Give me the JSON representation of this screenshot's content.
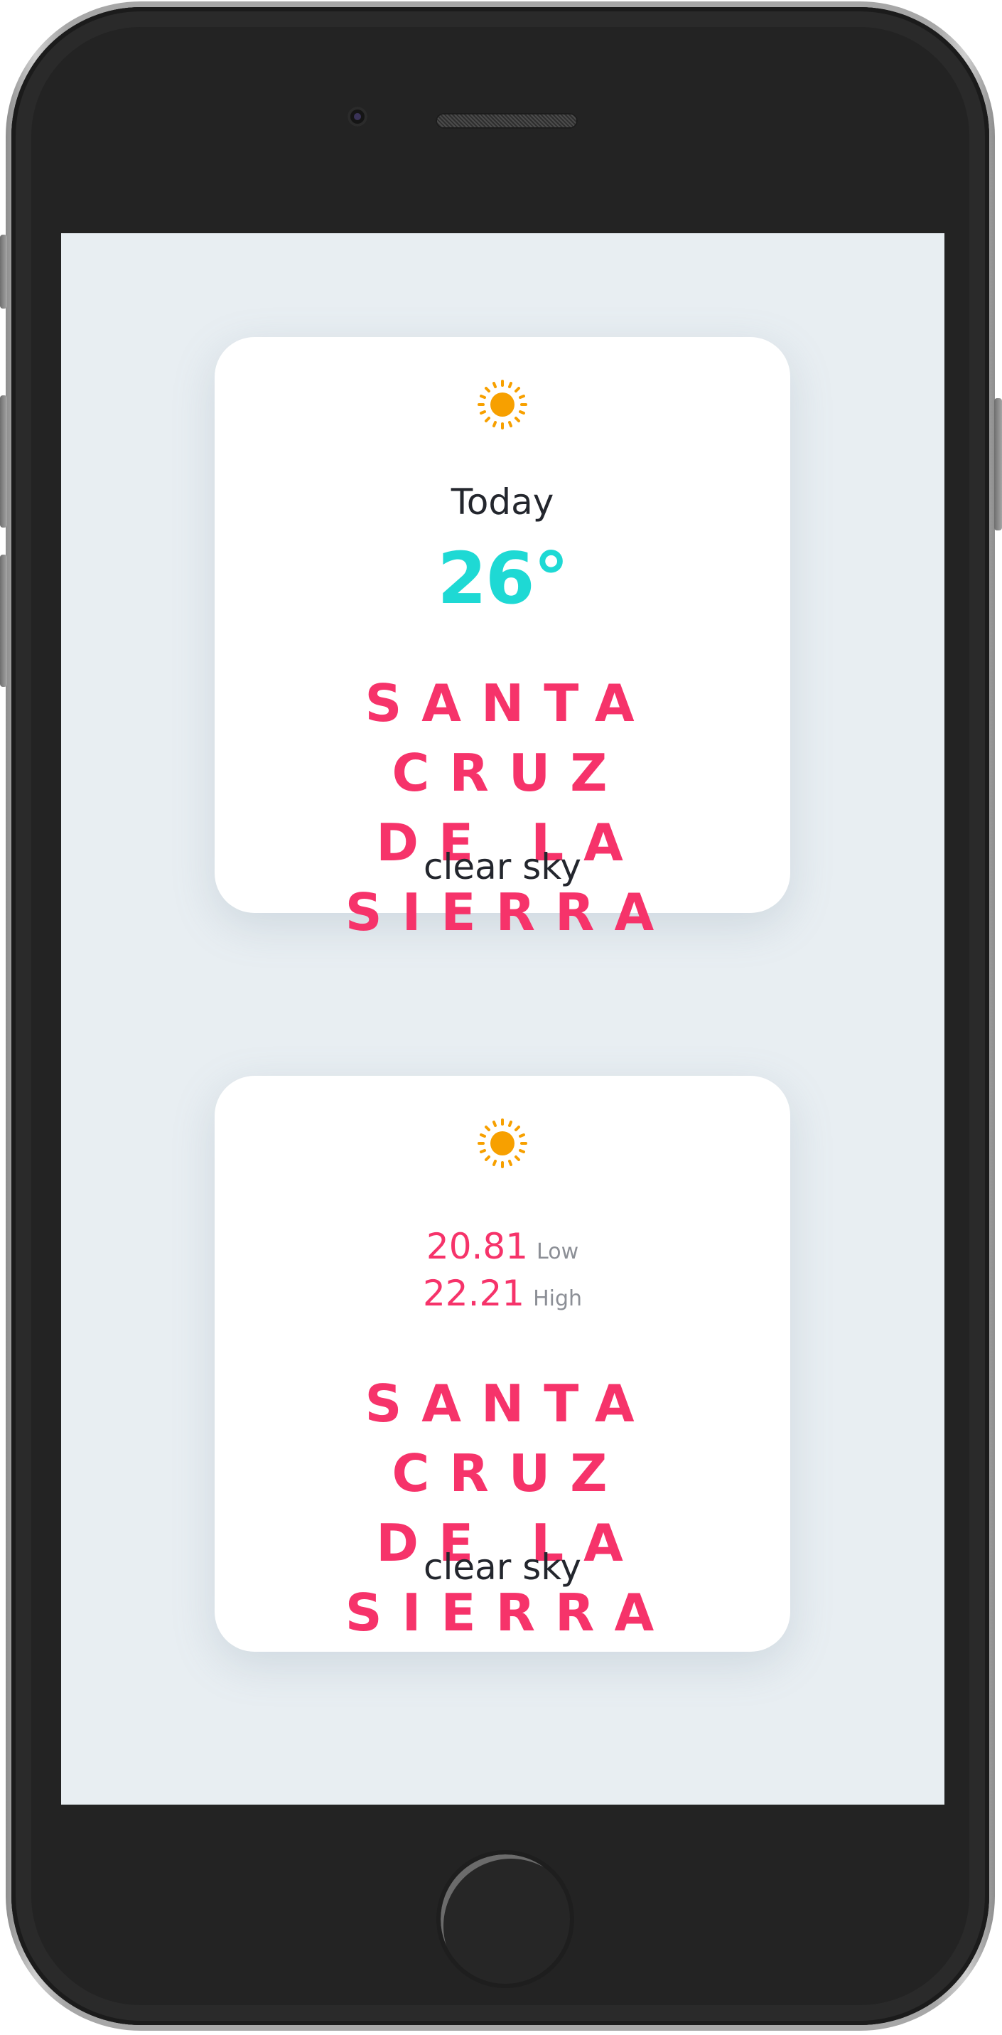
{
  "colors": {
    "accent_city": "#f6336a",
    "accent_temp": "#1ed9d4",
    "sun": "#f7a000",
    "screen_bg": "#e8eef2"
  },
  "current_card": {
    "icon": "sun-icon",
    "day_label": "Today",
    "temperature": "26°",
    "city_line1": "SANTA CRUZ",
    "city_line2": "DE LA SIERRA",
    "description": "clear sky"
  },
  "range_card": {
    "icon": "sun-icon",
    "low_value": "20.81",
    "low_label": "Low",
    "high_value": "22.21",
    "high_label": "High",
    "city_line1": "SANTA CRUZ",
    "city_line2": "DE LA SIERRA",
    "description": "clear sky"
  }
}
